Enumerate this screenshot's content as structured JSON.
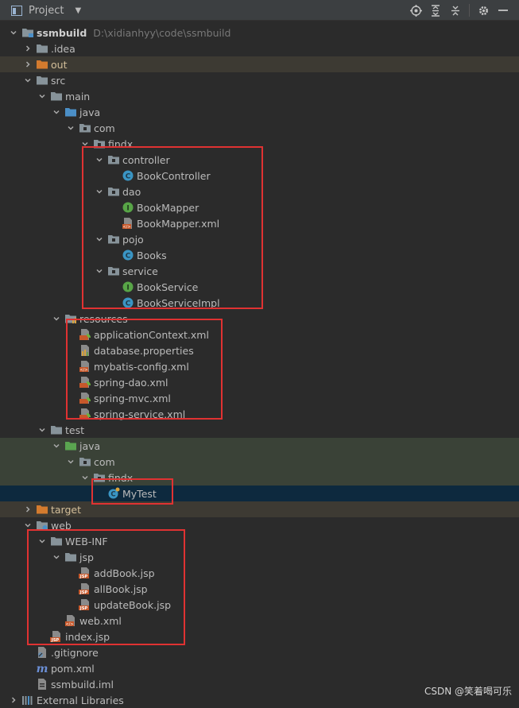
{
  "toolbar": {
    "title": "Project",
    "actions": [
      "locate-icon",
      "expand-all-icon",
      "collapse-all-icon",
      "gear-icon",
      "hide-icon"
    ]
  },
  "tree": [
    {
      "label": "ssmbuild",
      "path": "D:\\xidianhyy\\code\\ssmbuild",
      "depth": 0,
      "arrow": "down",
      "icon": "module-folder-icon",
      "bold": true
    },
    {
      "label": ".idea",
      "depth": 1,
      "arrow": "right",
      "icon": "folder-icon"
    },
    {
      "label": "out",
      "depth": 1,
      "arrow": "right",
      "icon": "excluded-folder-icon",
      "style": "excluded"
    },
    {
      "label": "src",
      "depth": 1,
      "arrow": "down",
      "icon": "folder-icon"
    },
    {
      "label": "main",
      "depth": 2,
      "arrow": "down",
      "icon": "folder-icon"
    },
    {
      "label": "java",
      "depth": 3,
      "arrow": "down",
      "icon": "source-folder-icon"
    },
    {
      "label": "com",
      "depth": 4,
      "arrow": "down",
      "icon": "package-icon"
    },
    {
      "label": "findx",
      "depth": 5,
      "arrow": "down",
      "icon": "package-icon"
    },
    {
      "label": "controller",
      "depth": 6,
      "arrow": "down",
      "icon": "package-icon"
    },
    {
      "label": "BookController",
      "depth": 7,
      "icon": "class-icon"
    },
    {
      "label": "dao",
      "depth": 6,
      "arrow": "down",
      "icon": "package-icon"
    },
    {
      "label": "BookMapper",
      "depth": 7,
      "icon": "interface-icon"
    },
    {
      "label": "BookMapper.xml",
      "depth": 7,
      "icon": "xml-file-icon"
    },
    {
      "label": "pojo",
      "depth": 6,
      "arrow": "down",
      "icon": "package-icon"
    },
    {
      "label": "Books",
      "depth": 7,
      "icon": "class-icon"
    },
    {
      "label": "service",
      "depth": 6,
      "arrow": "down",
      "icon": "package-icon"
    },
    {
      "label": "BookService",
      "depth": 7,
      "icon": "interface-icon"
    },
    {
      "label": "BookServiceImpl",
      "depth": 7,
      "icon": "class-icon"
    },
    {
      "label": "resources",
      "depth": 3,
      "arrow": "down",
      "icon": "resources-folder-icon"
    },
    {
      "label": "applicationContext.xml",
      "depth": 4,
      "icon": "spring-xml-icon"
    },
    {
      "label": "database.properties",
      "depth": 4,
      "icon": "properties-file-icon"
    },
    {
      "label": "mybatis-config.xml",
      "depth": 4,
      "icon": "xml-file-icon"
    },
    {
      "label": "spring-dao.xml",
      "depth": 4,
      "icon": "spring-xml-icon"
    },
    {
      "label": "spring-mvc.xml",
      "depth": 4,
      "icon": "spring-xml-icon"
    },
    {
      "label": "spring-service.xml",
      "depth": 4,
      "icon": "spring-xml-icon"
    },
    {
      "label": "test",
      "depth": 2,
      "arrow": "down",
      "icon": "folder-icon"
    },
    {
      "label": "java",
      "depth": 3,
      "arrow": "down",
      "icon": "test-source-folder-icon",
      "style": "test"
    },
    {
      "label": "com",
      "depth": 4,
      "arrow": "down",
      "icon": "package-icon",
      "style": "test"
    },
    {
      "label": "findx",
      "depth": 5,
      "arrow": "down",
      "icon": "package-icon",
      "style": "test"
    },
    {
      "label": "MyTest",
      "depth": 6,
      "icon": "test-class-icon",
      "style": "selected"
    },
    {
      "label": "target",
      "depth": 1,
      "arrow": "right",
      "icon": "excluded-folder-icon",
      "style": "excluded"
    },
    {
      "label": "web",
      "depth": 1,
      "arrow": "down",
      "icon": "web-folder-icon"
    },
    {
      "label": "WEB-INF",
      "depth": 2,
      "arrow": "down",
      "icon": "folder-icon"
    },
    {
      "label": "jsp",
      "depth": 3,
      "arrow": "down",
      "icon": "folder-icon"
    },
    {
      "label": "addBook.jsp",
      "depth": 4,
      "icon": "jsp-file-icon"
    },
    {
      "label": "allBook.jsp",
      "depth": 4,
      "icon": "jsp-file-icon"
    },
    {
      "label": "updateBook.jsp",
      "depth": 4,
      "icon": "jsp-file-icon"
    },
    {
      "label": "web.xml",
      "depth": 3,
      "icon": "xml-file-icon"
    },
    {
      "label": "index.jsp",
      "depth": 2,
      "icon": "jsp-file-icon"
    },
    {
      "label": ".gitignore",
      "depth": 1,
      "icon": "gitignore-icon"
    },
    {
      "label": "pom.xml",
      "depth": 1,
      "icon": "maven-icon"
    },
    {
      "label": "ssmbuild.iml",
      "depth": 1,
      "icon": "iml-file-icon"
    },
    {
      "label": "External Libraries",
      "depth": 0,
      "arrow": "right",
      "icon": "libraries-icon"
    }
  ],
  "watermark": "CSDN @笑着喝可乐",
  "colors": {
    "background": "#2b2b2b",
    "toolbar": "#3c3f41",
    "selection": "#0d293e",
    "excluded_row": "#3d3a33",
    "test_row": "#3a4237",
    "highlight_box": "#e03232",
    "folder": "#87939a",
    "excluded_folder": "#d47b2e",
    "source_folder": "#4b8fc7",
    "test_folder": "#5aa550",
    "class_badge": "#3a95c4",
    "interface_badge": "#58a547"
  }
}
